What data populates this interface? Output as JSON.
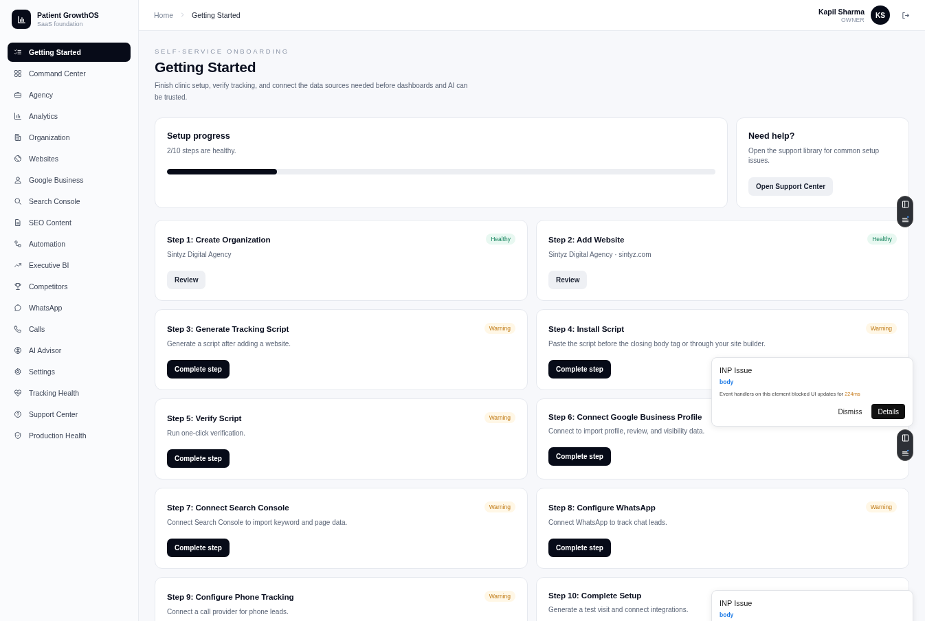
{
  "brand": {
    "name": "Patient GrowthOS",
    "tagline": "SaaS foundation"
  },
  "sidebar": {
    "items": [
      {
        "label": "Getting Started",
        "selected": true
      },
      {
        "label": "Command Center",
        "selected": false
      },
      {
        "label": "Agency",
        "selected": false
      },
      {
        "label": "Analytics",
        "selected": false
      },
      {
        "label": "Organization",
        "selected": false
      },
      {
        "label": "Websites",
        "selected": false
      },
      {
        "label": "Google Business",
        "selected": false
      },
      {
        "label": "Search Console",
        "selected": false
      },
      {
        "label": "SEO Content",
        "selected": false
      },
      {
        "label": "Automation",
        "selected": false
      },
      {
        "label": "Executive BI",
        "selected": false
      },
      {
        "label": "Competitors",
        "selected": false
      },
      {
        "label": "WhatsApp",
        "selected": false
      },
      {
        "label": "Calls",
        "selected": false
      },
      {
        "label": "AI Advisor",
        "selected": false
      },
      {
        "label": "Settings",
        "selected": false
      },
      {
        "label": "Tracking Health",
        "selected": false
      },
      {
        "label": "Support Center",
        "selected": false
      },
      {
        "label": "Production Health",
        "selected": false
      }
    ]
  },
  "breadcrumb": [
    "Home",
    "Getting Started"
  ],
  "user": {
    "name": "Kapil Sharma",
    "role": "OWNER",
    "initials": "KS"
  },
  "page": {
    "eyebrow": "SELF-SERVICE ONBOARDING",
    "title": "Getting Started",
    "description": "Finish clinic setup, verify tracking, and connect the data sources needed before dashboards and AI can be trusted."
  },
  "progress": {
    "title": "Setup progress",
    "summary": "2/10 steps are healthy.",
    "level": 0.2
  },
  "help": {
    "title": "Need help?",
    "text": "Open the support library for common setup issues.",
    "button": "Open Support Center"
  },
  "steps": [
    {
      "title": "Step 1: Create Organization",
      "status": "Healthy",
      "kind": "healthy",
      "detail": "Sintyz Digital Agency",
      "button": {
        "label": "Review",
        "kind": "review"
      }
    },
    {
      "title": "Step 2: Add Website",
      "status": "Healthy",
      "kind": "healthy",
      "detail": "Sintyz Digital Agency · sintyz.com",
      "button": {
        "label": "Review",
        "kind": "review"
      }
    },
    {
      "title": "Step 3: Generate Tracking Script",
      "status": "Warning",
      "kind": "warning",
      "detail": "Generate a script after adding a website.",
      "button": {
        "label": "Complete step",
        "kind": "complete"
      }
    },
    {
      "title": "Step 4: Install Script",
      "status": "Warning",
      "kind": "warning",
      "detail": "Paste the script before the closing body tag or through your site builder.",
      "button": {
        "label": "Complete step",
        "kind": "complete"
      }
    },
    {
      "title": "Step 5: Verify Script",
      "status": "Warning",
      "kind": "warning",
      "detail": "Run one-click verification.",
      "button": {
        "label": "Complete step",
        "kind": "complete"
      }
    },
    {
      "title": "Step 6: Connect Google Business Profile",
      "detail": "Connect to import profile, review, and visibility data.",
      "button": {
        "label": "Complete step",
        "kind": "complete"
      }
    },
    {
      "title": "Step 7: Connect Search Console",
      "status": "Warning",
      "kind": "warning",
      "detail": "Connect Search Console to import keyword and page data.",
      "button": {
        "label": "Complete step",
        "kind": "complete"
      }
    },
    {
      "title": "Step 8: Configure WhatsApp",
      "status": "Warning",
      "kind": "warning",
      "detail": "Connect WhatsApp to track chat leads.",
      "button": {
        "label": "Complete step",
        "kind": "complete"
      }
    },
    {
      "title": "Step 9: Configure Phone Tracking",
      "status": "Warning",
      "kind": "warning",
      "detail": "Connect a call provider for phone leads."
    },
    {
      "title": "Step 10: Complete Setup",
      "detail": "Generate a test visit and connect integrations."
    }
  ],
  "issue_popups": [
    {
      "title": "INP Issue",
      "selector": "body",
      "message": "Event handlers on this element blocked UI updates for",
      "duration": "224ms",
      "dismiss": "Dismiss",
      "details": "Details"
    },
    {
      "title": "INP Issue",
      "selector": "body"
    }
  ]
}
